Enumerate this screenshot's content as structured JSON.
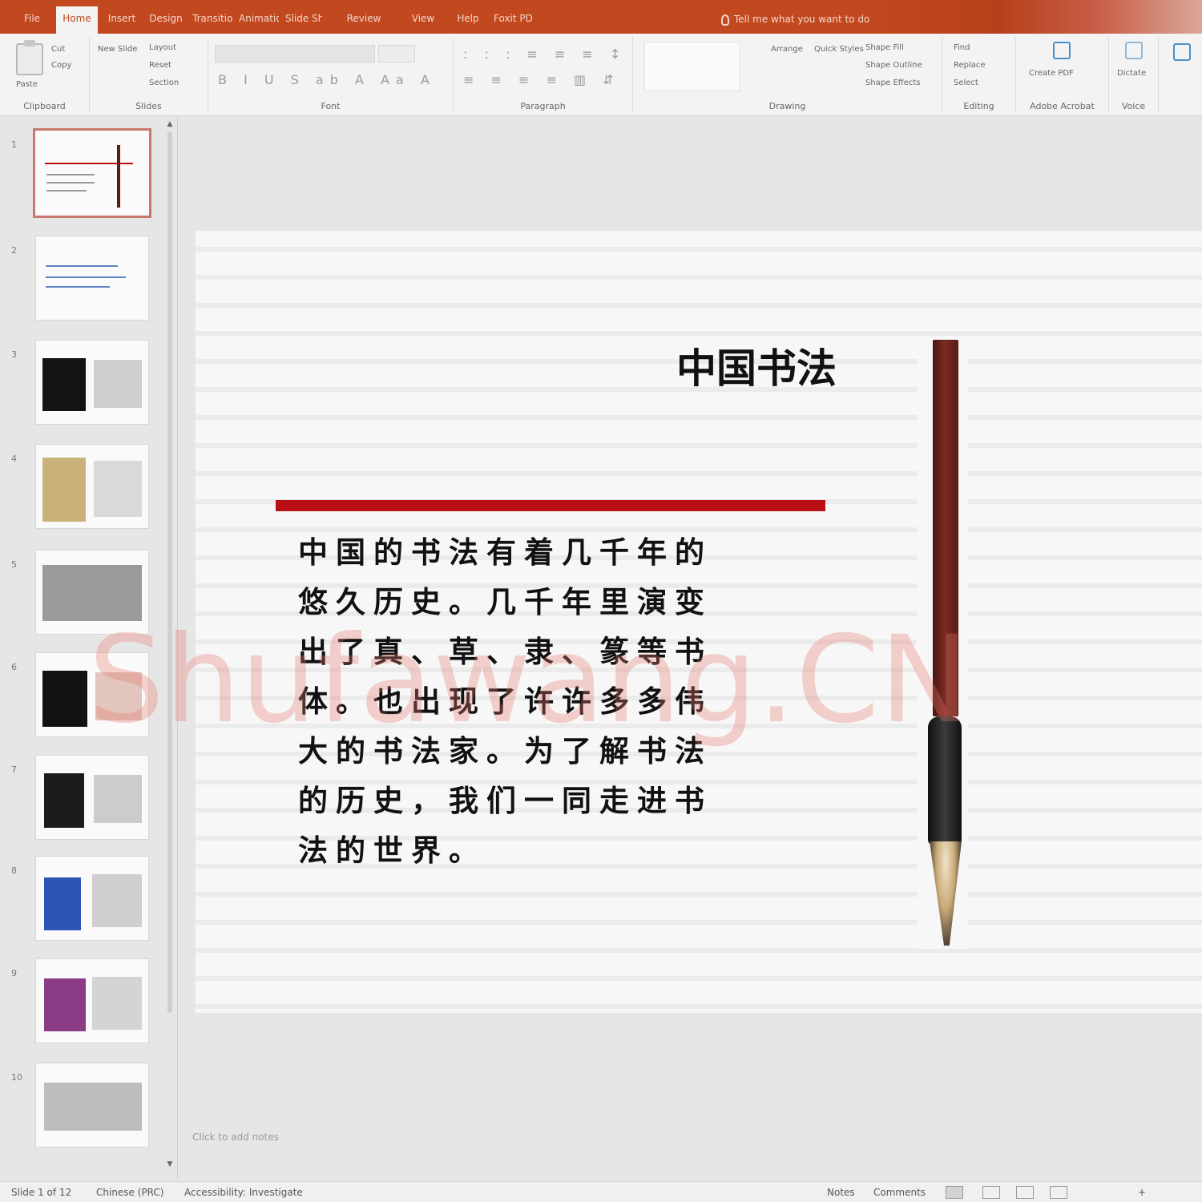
{
  "app": {
    "tabs": [
      "File",
      "Home",
      "Insert",
      "Design",
      "Transitions",
      "Animations",
      "Slide Show",
      "Review",
      "View",
      "Help",
      "Foxit PDF"
    ],
    "active_tab": "Home",
    "search": "Tell me what you want to do",
    "accent_color": "#c2481f"
  },
  "ribbon": {
    "groups": [
      {
        "label": "Clipboard",
        "buttons": [
          "Paste",
          "Cut",
          "Copy"
        ]
      },
      {
        "label": "Slides",
        "buttons": [
          "New Slide",
          "Layout",
          "Reset",
          "Section"
        ]
      },
      {
        "label": "Font",
        "buttons": []
      },
      {
        "label": "Paragraph",
        "buttons": []
      },
      {
        "label": "Drawing",
        "buttons": [
          "Arrange",
          "Quick Styles",
          "Shape Fill",
          "Shape Outline",
          "Shape Effects"
        ]
      },
      {
        "label": "Editing",
        "buttons": [
          "Find",
          "Replace",
          "Select"
        ]
      },
      {
        "label": "Adobe Acrobat",
        "buttons": [
          "Create PDF"
        ]
      },
      {
        "label": "Voice",
        "buttons": [
          "Dictate"
        ]
      }
    ]
  },
  "slides_panel": {
    "numbers": [
      "1",
      "2",
      "3",
      "4",
      "5",
      "6",
      "7",
      "8",
      "9",
      "10"
    ],
    "selected": 1
  },
  "slide": {
    "title": "中国书法",
    "body": "中国的书法有着几千年的悠久历史。几千年里演变出了真、草、隶、篆等书体。也出现了许许多多伟大的书法家。为了解书法的历史，我们一同走进书法的世界。",
    "rule_color": "#b90f14"
  },
  "watermark": "Shufawang.CN",
  "notes_hint": "Click to add notes",
  "statusbar": {
    "slide_info": "Slide 1 of 12",
    "language": "Chinese (PRC)",
    "accessibility": "Accessibility: Investigate",
    "notes": "Notes",
    "comments": "Comments",
    "zoom": "+"
  }
}
